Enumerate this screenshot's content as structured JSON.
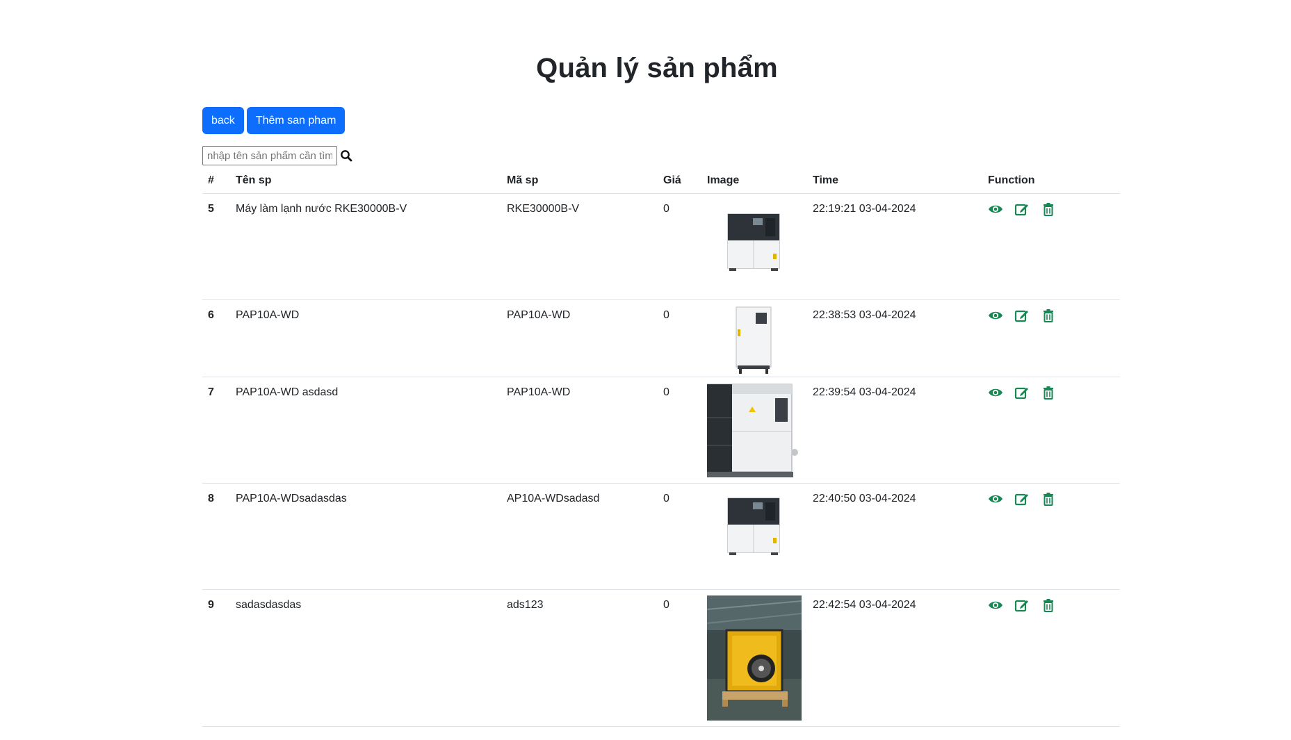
{
  "page": {
    "title": "Quản lý sản phẩm"
  },
  "toolbar": {
    "back_label": "back",
    "add_label": "Thêm san pham"
  },
  "search": {
    "placeholder": "nhập tên sản phẩm cần tìm"
  },
  "table": {
    "headers": [
      "#",
      "Tên sp",
      "Mã sp",
      "Giá",
      "Image",
      "Time",
      "Function"
    ],
    "rows": [
      {
        "id": "5",
        "name": "Máy làm lạnh nước RKE30000B-V",
        "code": "RKE30000B-V",
        "price": "0",
        "image": "chiller-dark-panel",
        "time": "22:19:21 03-04-2024"
      },
      {
        "id": "6",
        "name": "PAP10A-WD",
        "code": "PAP10A-WD",
        "price": "0",
        "image": "chiller-tall-white",
        "time": "22:38:53 03-04-2024"
      },
      {
        "id": "7",
        "name": "PAP10A-WD asdasd",
        "code": "PAP10A-WD",
        "price": "0",
        "image": "chiller-large-white",
        "time": "22:39:54 03-04-2024"
      },
      {
        "id": "8",
        "name": "PAP10A-WDsadasdas",
        "code": "AP10A-WDsadasd",
        "price": "0",
        "image": "chiller-dark-panel",
        "time": "22:40:50 03-04-2024"
      },
      {
        "id": "9",
        "name": "sadasdasdas",
        "code": "ads123",
        "price": "0",
        "image": "yellow-fan-unit-photo",
        "time": "22:42:54 03-04-2024"
      }
    ]
  },
  "colors": {
    "primary": "#0d6efd",
    "action_icon": "#198754",
    "border": "#dee2e6"
  },
  "icons": {
    "view": "eye-icon",
    "edit": "edit-icon",
    "delete": "trash-icon",
    "search": "search-icon"
  }
}
